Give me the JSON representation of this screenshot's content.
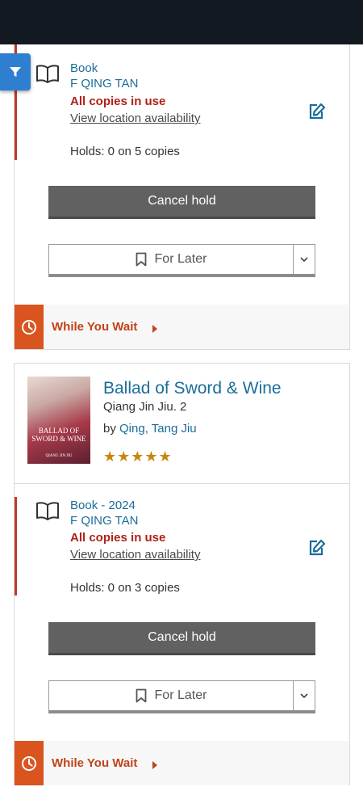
{
  "items": [
    {
      "format": "Book",
      "call_number": "F QING TAN",
      "status": "All copies in use",
      "view_location": "View location availability",
      "holds": "Holds: 0 on 5 copies",
      "cancel_label": "Cancel hold",
      "for_later_label": "For Later",
      "while_you_wait_label": "While You Wait"
    },
    {
      "title": "Ballad of Sword & Wine",
      "series": "Qiang Jin Jiu. 2",
      "by_prefix": "by ",
      "author": "Qing, Tang Jiu",
      "rating_stars": "★★★★★",
      "rating": 5,
      "cover_title": "BALLAD OF SWORD & WINE",
      "cover_author": "QIANG JIN JIU",
      "format": "Book - 2024",
      "call_number": "F QING TAN",
      "status": "All copies in use",
      "view_location": "View location availability",
      "holds": "Holds: 0 on 3 copies",
      "cancel_label": "Cancel hold",
      "for_later_label": "For Later",
      "while_you_wait_label": "While You Wait"
    }
  ],
  "colors": {
    "link": "#1a6e9a",
    "status_red": "#b0201a",
    "accent_orange": "#d9541e",
    "filter_blue": "#2f7fd0",
    "star_gold": "#c8860c"
  },
  "icons": {
    "filter": "filter-icon",
    "book": "book-icon",
    "edit": "edit-icon",
    "bookmark": "bookmark-icon",
    "caret": "chevron-down-icon",
    "clock": "clock-icon"
  }
}
